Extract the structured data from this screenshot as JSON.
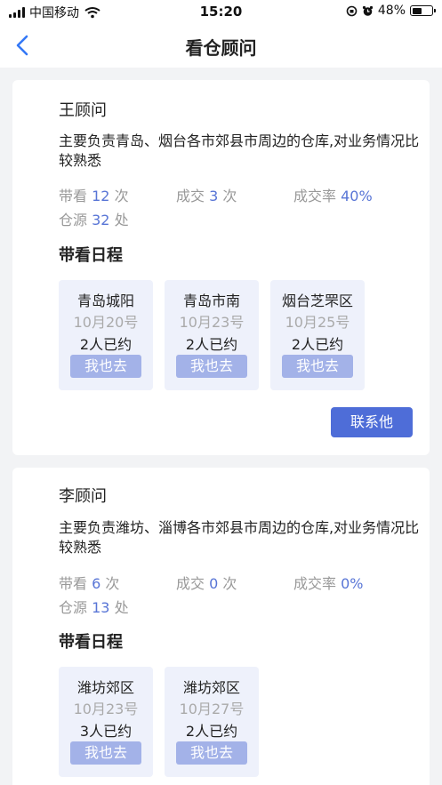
{
  "status_bar": {
    "carrier": "中国移动",
    "time": "15:20",
    "battery": "48%",
    "battery_level": 0.48
  },
  "nav": {
    "title": "看仓顾问",
    "back_icon": "chevron-left-icon"
  },
  "colors": {
    "accent": "#4e6dd8",
    "number": "#5875d6",
    "slot_bg": "#eef1fb",
    "slot_button": "#a3b2e8"
  },
  "advisors": [
    {
      "name": "王顾问",
      "description": "主要负责青岛、烟台各市郊县市周边的仓库,对业务情况比较熟悉",
      "stats": {
        "visits_label": "带看",
        "visits_value": "12",
        "visits_unit": "次",
        "deals_label": "成交",
        "deals_value": "3",
        "deals_unit": "次",
        "rate_label": "成交率",
        "rate_value": "40%",
        "sources_label": "仓源",
        "sources_value": "32",
        "sources_unit": "处"
      },
      "schedule_title": "带看日程",
      "schedule": [
        {
          "location": "青岛城阳",
          "date": "10月20号",
          "booked": "2人已约",
          "button": "我也去"
        },
        {
          "location": "青岛市南",
          "date": "10月23号",
          "booked": "2人已约",
          "button": "我也去"
        },
        {
          "location": "烟台芝罘区",
          "date": "10月25号",
          "booked": "2人已约",
          "button": "我也去"
        }
      ],
      "contact_button": "联系他"
    },
    {
      "name": "李顾问",
      "description": "主要负责潍坊、淄博各市郊县市周边的仓库,对业务情况比较熟悉",
      "stats": {
        "visits_label": "带看",
        "visits_value": "6",
        "visits_unit": "次",
        "deals_label": "成交",
        "deals_value": "0",
        "deals_unit": "次",
        "rate_label": "成交率",
        "rate_value": "0%",
        "sources_label": "仓源",
        "sources_value": "13",
        "sources_unit": "处"
      },
      "schedule_title": "带看日程",
      "schedule": [
        {
          "location": "潍坊郊区",
          "date": "10月23号",
          "booked": "3人已约",
          "button": "我也去"
        },
        {
          "location": "潍坊郊区",
          "date": "10月27号",
          "booked": "2人已约",
          "button": "我也去"
        }
      ]
    }
  ]
}
